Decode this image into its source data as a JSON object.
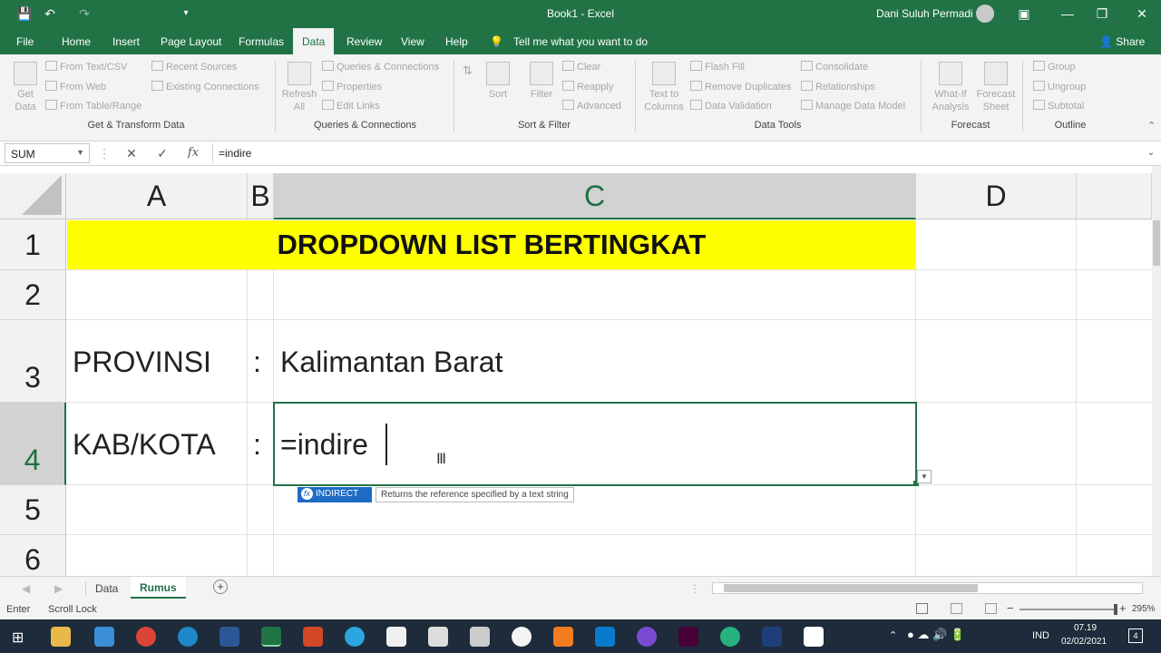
{
  "titlebar": {
    "title": "Book1  -  Excel",
    "user": "Dani Suluh Permadi"
  },
  "menu": {
    "items": [
      "File",
      "Home",
      "Insert",
      "Page Layout",
      "Formulas",
      "Data",
      "Review",
      "View",
      "Help"
    ],
    "active": "Data",
    "tell_me": "Tell me what you want to do",
    "share": "Share"
  },
  "ribbon": {
    "get_data": "Get Data",
    "from_text_csv": "From Text/CSV",
    "from_web": "From Web",
    "from_table": "From Table/Range",
    "recent_sources": "Recent Sources",
    "existing_connections": "Existing Connections",
    "group1": "Get & Transform Data",
    "refresh_all": "Refresh All",
    "queries_connections": "Queries & Connections",
    "properties": "Properties",
    "edit_links": "Edit Links",
    "group2": "Queries & Connections",
    "sort": "Sort",
    "filter": "Filter",
    "clear": "Clear",
    "reapply": "Reapply",
    "advanced": "Advanced",
    "group3": "Sort & Filter",
    "text_to_columns": "Text to Columns",
    "flash_fill": "Flash Fill",
    "remove_duplicates": "Remove Duplicates",
    "data_validation": "Data Validation",
    "consolidate": "Consolidate",
    "relationships": "Relationships",
    "manage_data_model": "Manage Data Model",
    "group4": "Data Tools",
    "what_if": "What-If Analysis",
    "forecast_sheet": "Forecast Sheet",
    "group5": "Forecast",
    "group_btn": "Group",
    "ungroup": "Ungroup",
    "subtotal": "Subtotal",
    "group6": "Outline"
  },
  "formula_bar": {
    "name_box": "SUM",
    "formula": "=indire"
  },
  "grid": {
    "columns": [
      "A",
      "B",
      "C",
      "D"
    ],
    "rows": [
      "1",
      "2",
      "3",
      "4",
      "5",
      "6"
    ],
    "banner": "DROPDOWN LIST BERTINGKAT",
    "a3": "PROVINSI",
    "b3": ":",
    "c3": "Kalimantan Barat",
    "a4": "KAB/KOTA",
    "b4": ":",
    "c4": "=indire"
  },
  "autocomplete": {
    "function": "INDIRECT",
    "description": "Returns the reference specified by a text string"
  },
  "sheets": {
    "tabs": [
      "Data",
      "Rumus"
    ],
    "active": "Rumus"
  },
  "status": {
    "mode": "Enter",
    "scroll_lock": "Scroll Lock",
    "zoom": "295%"
  },
  "taskbar": {
    "lang": "IND",
    "time": "07.19",
    "date": "02/02/2021"
  },
  "colors": {
    "excel_green": "#217346",
    "banner_yellow": "#ffff00"
  }
}
